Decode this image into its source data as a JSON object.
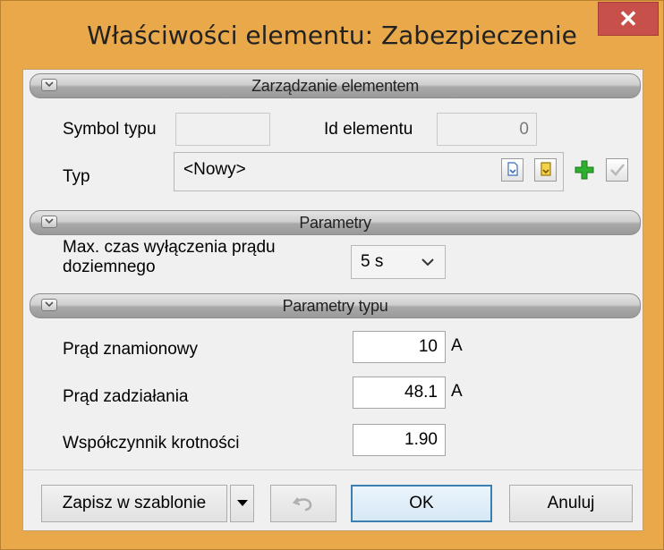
{
  "window": {
    "title": "Właściwości elementu: Zabezpieczenie",
    "close_glyph": "✕"
  },
  "section_manage": {
    "title": "Zarządzanie elementem",
    "symbol_label": "Symbol typu",
    "symbol_value": "",
    "id_label": "Id elementu",
    "id_value": "0",
    "type_label": "Typ",
    "type_value": "<Nowy>"
  },
  "section_params": {
    "title": "Parametry",
    "time_label_line1": "Max. czas wyłączenia prądu",
    "time_label_line2": "doziemnego",
    "time_value": "5 s"
  },
  "section_type_params": {
    "title": "Parametry typu",
    "rated_label": "Prąd znamionowy",
    "rated_value": "10",
    "rated_unit": "A",
    "trip_label": "Prąd zadziałania",
    "trip_value": "48.1",
    "trip_unit": "A",
    "factor_label": "Współczynnik krotności",
    "factor_value": "1.90"
  },
  "footer": {
    "save_template_label": "Zapisz w szablonie",
    "ok_label": "OK",
    "cancel_label": "Anuluj"
  },
  "colors": {
    "frame": "#e9a84a",
    "close": "#c7504b",
    "client": "#f0f0f0",
    "default_button_border": "#3c7fb1"
  }
}
